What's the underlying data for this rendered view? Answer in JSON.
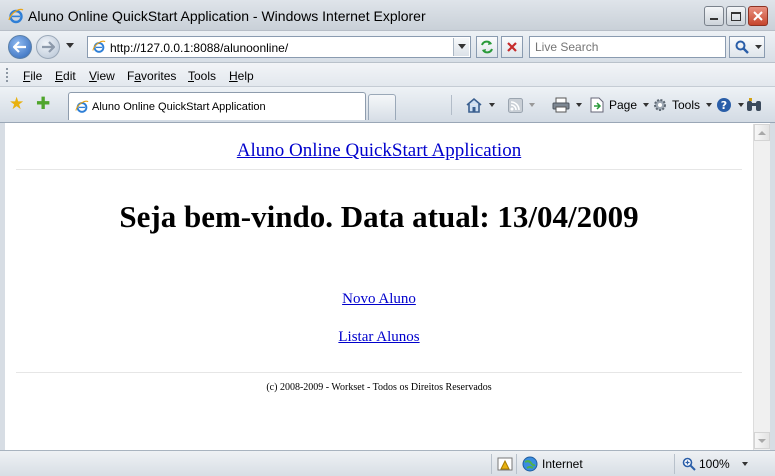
{
  "window": {
    "title": "Aluno Online QuickStart Application - Windows Internet Explorer"
  },
  "address_bar": {
    "url": "http://127.0.0.1:8088/alunoonline/"
  },
  "search": {
    "placeholder": "Live Search"
  },
  "menu": {
    "items": [
      {
        "label": "File",
        "accel": "F"
      },
      {
        "label": "Edit",
        "accel": "E"
      },
      {
        "label": "View",
        "accel": "V"
      },
      {
        "label": "Favorites",
        "accel": "a"
      },
      {
        "label": "Tools",
        "accel": "T"
      },
      {
        "label": "Help",
        "accel": "H"
      }
    ]
  },
  "tabs": [
    {
      "label": "Aluno Online QuickStart Application",
      "active": true
    }
  ],
  "command_bar": {
    "page_label": "Page",
    "tools_label": "Tools"
  },
  "page": {
    "app_title": "Aluno Online QuickStart Application",
    "welcome": "Seja bem-vindo. Data atual: 13/04/2009",
    "links": [
      {
        "label": "Novo Aluno"
      },
      {
        "label": "Listar Alunos"
      }
    ],
    "footer": "(c) 2008-2009 - Workset - Todos os Direitos Reservados"
  },
  "status_bar": {
    "zone": "Internet",
    "zoom": "100%"
  },
  "colors": {
    "link": "#0000cc",
    "titlebar": "#dfe4ea",
    "close_button": "#c6462d"
  }
}
